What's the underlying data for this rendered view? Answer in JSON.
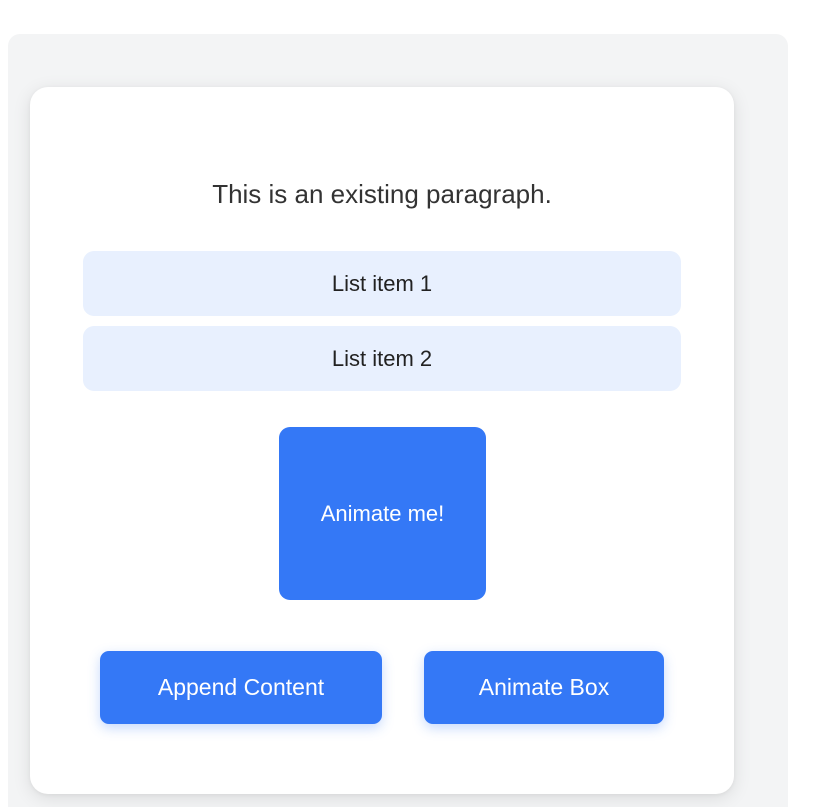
{
  "main": {
    "paragraph": "This is an existing paragraph.",
    "list_items": [
      {
        "label": "List item 1"
      },
      {
        "label": "List item 2"
      }
    ],
    "animate_box_label": "Animate me!"
  },
  "buttons": {
    "append_label": "Append Content",
    "animate_label": "Animate Box"
  },
  "colors": {
    "accent": "#3478f6",
    "list_item_bg": "#e8f0fe",
    "card_bg": "#ffffff",
    "page_bg": "#f3f4f5"
  }
}
